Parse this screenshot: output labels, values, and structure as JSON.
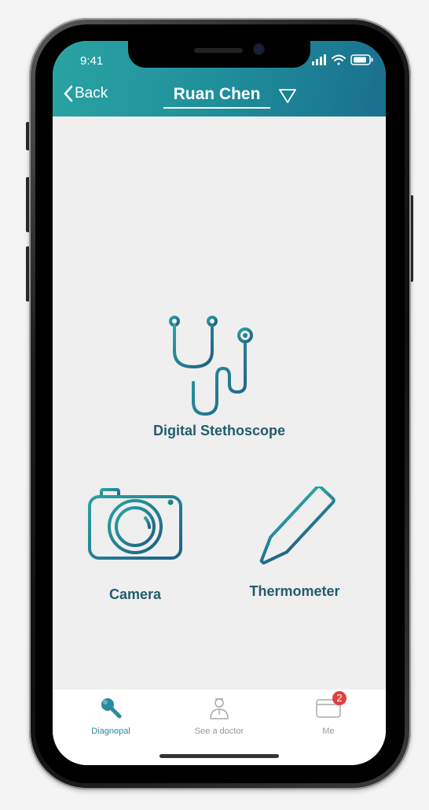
{
  "status_bar": {
    "time": "9:41"
  },
  "header": {
    "back_label": "Back",
    "title": "Ruan Chen",
    "back_icon": "chevron-left-icon",
    "dropdown_icon": "triangle-down-icon"
  },
  "features": [
    {
      "label": "Digital Stethoscope",
      "icon": "stethoscope-icon"
    },
    {
      "label": "Camera",
      "icon": "camera-icon"
    },
    {
      "label": "Thermometer",
      "icon": "thermometer-icon"
    }
  ],
  "tabbar": {
    "tabs": [
      {
        "label": "Diagnopal",
        "icon": "magnifier-icon",
        "active": true
      },
      {
        "label": "See a doctor",
        "icon": "doctor-icon",
        "active": false
      },
      {
        "label": "Me",
        "icon": "wallet-icon",
        "active": false,
        "badge": "2"
      }
    ]
  },
  "colors": {
    "accent": "#1f8f9a",
    "accent_dark": "#1a6f8e",
    "label": "#235c6c",
    "badge": "#e04040",
    "tab_active": "#2a8aa0",
    "tab_inactive": "#999999"
  }
}
